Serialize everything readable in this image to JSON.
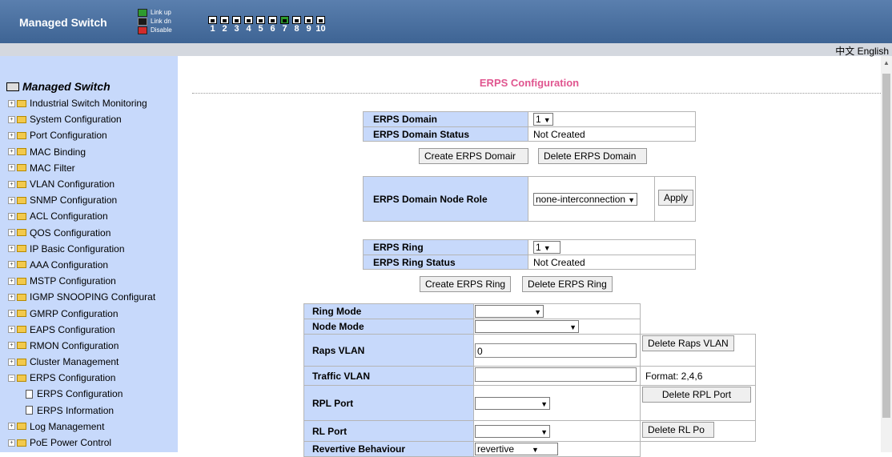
{
  "header": {
    "brand": "Managed Switch",
    "legend": [
      {
        "label": "Link up",
        "color": "#2e9b2e"
      },
      {
        "label": "Link dn",
        "color": "#1a1a1a"
      },
      {
        "label": "Disable",
        "color": "#d12b2b"
      }
    ],
    "ports": [
      "1",
      "2",
      "3",
      "4",
      "5",
      "6",
      "7",
      "8",
      "9",
      "10"
    ]
  },
  "lang": {
    "chinese": "中文",
    "english": "English"
  },
  "sidebar": {
    "title": "Managed Switch",
    "items": [
      {
        "label": "Industrial Switch Monitoring",
        "type": "folder"
      },
      {
        "label": "System Configuration",
        "type": "folder"
      },
      {
        "label": "Port Configuration",
        "type": "folder"
      },
      {
        "label": "MAC Binding",
        "type": "folder"
      },
      {
        "label": "MAC Filter",
        "type": "folder"
      },
      {
        "label": "VLAN Configuration",
        "type": "folder"
      },
      {
        "label": "SNMP Configuration",
        "type": "folder"
      },
      {
        "label": "ACL Configuration",
        "type": "folder"
      },
      {
        "label": "QOS Configuration",
        "type": "folder"
      },
      {
        "label": "IP Basic Configuration",
        "type": "folder"
      },
      {
        "label": "AAA Configuration",
        "type": "folder"
      },
      {
        "label": "MSTP Configuration",
        "type": "folder"
      },
      {
        "label": "IGMP SNOOPING Configurat",
        "type": "folder"
      },
      {
        "label": "GMRP Configuration",
        "type": "folder"
      },
      {
        "label": "EAPS Configuration",
        "type": "folder"
      },
      {
        "label": "RMON Configuration",
        "type": "folder"
      },
      {
        "label": "Cluster Management",
        "type": "folder"
      },
      {
        "label": "ERPS Configuration",
        "type": "open-folder"
      },
      {
        "label": "ERPS Configuration",
        "type": "doc"
      },
      {
        "label": "ERPS Information",
        "type": "doc"
      },
      {
        "label": "Log Management",
        "type": "folder"
      },
      {
        "label": "PoE Power Control",
        "type": "folder"
      }
    ]
  },
  "page": {
    "title": "ERPS Configuration",
    "domain": {
      "label": "ERPS Domain",
      "value": "1",
      "status_label": "ERPS Domain Status",
      "status": "Not Created",
      "create_btn": "Create ERPS Domair",
      "delete_btn": "Delete ERPS Domain"
    },
    "node_role": {
      "label": "ERPS Domain Node Role",
      "value": "none-interconnection",
      "apply_btn": "Apply"
    },
    "ring": {
      "label": "ERPS Ring",
      "value": "1",
      "status_label": "ERPS Ring Status",
      "status": "Not Created",
      "create_btn": "Create ERPS Ring",
      "delete_btn": "Delete ERPS Ring"
    },
    "ring_cfg": {
      "ring_mode": "Ring Mode",
      "node_mode": "Node Mode",
      "raps_vlan": "Raps VLAN",
      "raps_vlan_value": "0",
      "delete_raps_vlan": "Delete Raps VLAN",
      "traffic_vlan": "Traffic VLAN",
      "traffic_vlan_value": "",
      "traffic_format": "Format: 2,4,6",
      "rpl_port": "RPL Port",
      "delete_rpl_port": "Delete RPL Port",
      "rl_port": "RL Port",
      "delete_rl_port": "Delete RL Po",
      "revertive": "Revertive Behaviour",
      "revertive_value": "revertive"
    }
  }
}
